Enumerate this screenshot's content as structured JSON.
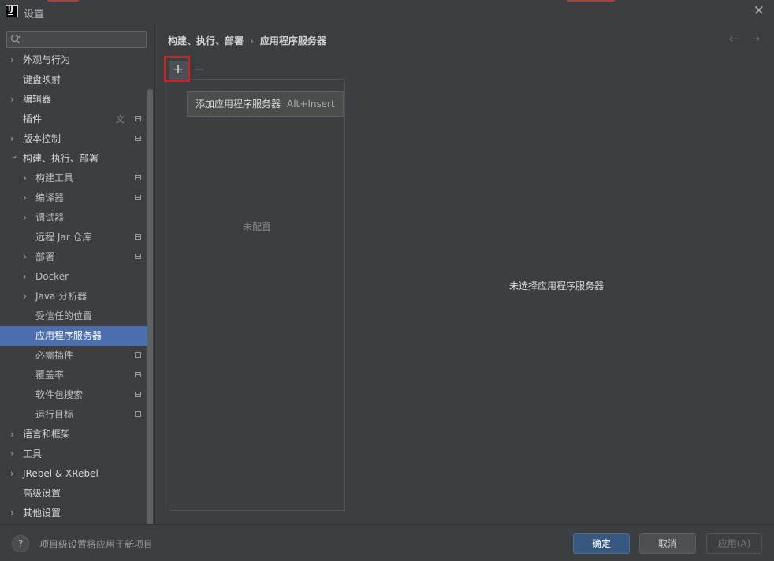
{
  "window": {
    "title": "设置",
    "close": "✕",
    "logo": "IJ"
  },
  "sidebar": {
    "search": {
      "placeholder": ""
    },
    "items": [
      {
        "label": "外观与行为",
        "level": 0,
        "expandable": true,
        "expanded": false
      },
      {
        "label": "键盘映射",
        "level": 0,
        "expandable": false
      },
      {
        "label": "编辑器",
        "level": 0,
        "expandable": true,
        "expanded": false
      },
      {
        "label": "插件",
        "level": 0,
        "expandable": false,
        "icons": [
          "translate-icon",
          "project-icon"
        ]
      },
      {
        "label": "版本控制",
        "level": 0,
        "expandable": true,
        "expanded": false,
        "icons": [
          "project-icon"
        ]
      },
      {
        "label": "构建、执行、部署",
        "level": 0,
        "expandable": true,
        "expanded": true
      },
      {
        "label": "构建工具",
        "level": 1,
        "expandable": true,
        "expanded": false,
        "icons": [
          "project-icon"
        ]
      },
      {
        "label": "编译器",
        "level": 1,
        "expandable": true,
        "expanded": false,
        "icons": [
          "project-icon"
        ]
      },
      {
        "label": "调试器",
        "level": 1,
        "expandable": true,
        "expanded": false
      },
      {
        "label": "远程 Jar 仓库",
        "level": 1,
        "expandable": false,
        "icons": [
          "project-icon"
        ]
      },
      {
        "label": "部署",
        "level": 1,
        "expandable": true,
        "expanded": false,
        "icons": [
          "project-icon"
        ]
      },
      {
        "label": "Docker",
        "level": 1,
        "expandable": true,
        "expanded": false
      },
      {
        "label": "Java 分析器",
        "level": 1,
        "expandable": true,
        "expanded": false
      },
      {
        "label": "受信任的位置",
        "level": 1,
        "expandable": false
      },
      {
        "label": "应用程序服务器",
        "level": 1,
        "expandable": false,
        "selected": true
      },
      {
        "label": "必需插件",
        "level": 1,
        "expandable": false,
        "icons": [
          "project-icon"
        ]
      },
      {
        "label": "覆盖率",
        "level": 1,
        "expandable": false,
        "icons": [
          "project-icon"
        ]
      },
      {
        "label": "软件包搜索",
        "level": 1,
        "expandable": false,
        "icons": [
          "project-icon"
        ]
      },
      {
        "label": "运行目标",
        "level": 1,
        "expandable": false,
        "icons": [
          "project-icon"
        ]
      },
      {
        "label": "语言和框架",
        "level": 0,
        "expandable": true,
        "expanded": false
      },
      {
        "label": "工具",
        "level": 0,
        "expandable": true,
        "expanded": false
      },
      {
        "label": "JRebel & XRebel",
        "level": 0,
        "expandable": true,
        "expanded": false
      },
      {
        "label": "高级设置",
        "level": 0,
        "expandable": false
      },
      {
        "label": "其他设置",
        "level": 0,
        "expandable": true,
        "expanded": false
      }
    ]
  },
  "main": {
    "breadcrumb": {
      "parent": "构建、执行、部署",
      "separator": "›",
      "current": "应用程序服务器"
    },
    "nav": {
      "back": "←",
      "forward": "→"
    },
    "toolbar": {
      "add": "+",
      "remove": "−"
    },
    "tooltip": {
      "text": "添加应用程序服务器",
      "shortcut": "Alt+Insert"
    },
    "list_empty": "未配置",
    "details_empty": "未选择应用程序服务器"
  },
  "footer": {
    "help": "?",
    "note": "项目级设置将应用于新项目",
    "ok": "确定",
    "cancel": "取消",
    "apply": "应用(A)"
  },
  "colors": {
    "accent": "#4b6eaf",
    "background": "#3c3f41",
    "highlight_box": "#e11a1a",
    "ok_button": "#365880"
  }
}
